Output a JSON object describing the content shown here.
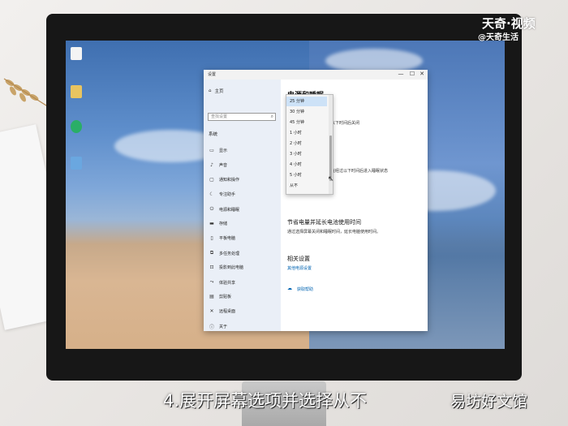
{
  "window": {
    "title": "设置",
    "controls": {
      "minimize": "—",
      "maximize": "☐",
      "close": "✕"
    }
  },
  "sidebar": {
    "home_label": "主页",
    "search_placeholder": "查找设置",
    "section_label": "系统",
    "items": [
      {
        "label": "显示",
        "icon": "display-icon"
      },
      {
        "label": "声音",
        "icon": "sound-icon"
      },
      {
        "label": "通知和操作",
        "icon": "notification-icon"
      },
      {
        "label": "专注助手",
        "icon": "moon-icon"
      },
      {
        "label": "电源和睡眠",
        "icon": "power-icon"
      },
      {
        "label": "存储",
        "icon": "storage-icon"
      },
      {
        "label": "平板电脑",
        "icon": "tablet-icon"
      },
      {
        "label": "多任务处理",
        "icon": "multitask-icon"
      },
      {
        "label": "投影到此电脑",
        "icon": "projection-icon"
      },
      {
        "label": "体验共享",
        "icon": "share-icon"
      },
      {
        "label": "剪贴板",
        "icon": "clipboard-icon"
      },
      {
        "label": "远程桌面",
        "icon": "remote-icon"
      },
      {
        "label": "关于",
        "icon": "info-icon"
      }
    ]
  },
  "main": {
    "title": "电源和睡眠",
    "screen_off_text": "以下时间后关闭",
    "sleep_text": "在经过以下时间后进入睡眠状态",
    "save_power_heading": "节省电量并延长电池使用时间",
    "save_power_desc": "通过选择屏幕关闭和睡眠时间，延长电脑使用时间。",
    "related_heading": "相关设置",
    "related_link": "其他电源设置",
    "help_link": "获取帮助"
  },
  "dropdown": {
    "selected_index": 0,
    "options": [
      "25 分钟",
      "30 分钟",
      "45 分钟",
      "1 小时",
      "2 小时",
      "3 小时",
      "4 小时",
      "5 小时",
      "从不"
    ]
  },
  "overlay": {
    "watermark_top": "天奇·视频",
    "watermark_sub": "@天奇生活",
    "subtitle": "4.展开屏幕选项并选择从不",
    "credit": "易坊好文馆"
  },
  "colors": {
    "accent": "#0063b1",
    "selected": "#cde2f7"
  }
}
